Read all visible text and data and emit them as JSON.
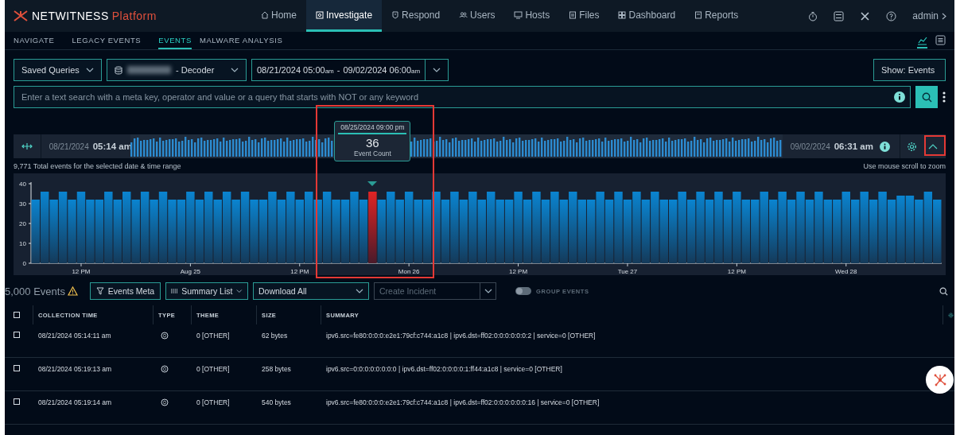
{
  "brand": {
    "name": "NETWITNESS",
    "product": "Platform"
  },
  "nav": [
    {
      "label": "Home",
      "selected": false
    },
    {
      "label": "Investigate",
      "selected": true
    },
    {
      "label": "Respond",
      "selected": false
    },
    {
      "label": "Users",
      "selected": false
    },
    {
      "label": "Hosts",
      "selected": false
    },
    {
      "label": "Files",
      "selected": false
    },
    {
      "label": "Dashboard",
      "selected": false
    },
    {
      "label": "Reports",
      "selected": false
    }
  ],
  "user": "admin",
  "subnav": [
    {
      "label": "NAVIGATE",
      "selected": false
    },
    {
      "label": "LEGACY EVENTS",
      "selected": false
    },
    {
      "label": "EVENTS",
      "selected": true
    },
    {
      "label": "MALWARE ANALYSIS",
      "selected": false
    }
  ],
  "view_toggles": [
    {
      "selected": true
    },
    {
      "selected": false
    }
  ],
  "query": {
    "saved_queries": "Saved Queries",
    "datasource": "- Decoder",
    "start_date": "08/21/2024 05:00",
    "start_ampm": "am",
    "separator": "-",
    "end_date": "09/02/2024 06:00",
    "end_ampm": "am",
    "show": "Show: Events"
  },
  "search": {
    "placeholder": "Enter a text search with a meta key, operator and value or a query that starts with NOT or any keyword"
  },
  "timeline": {
    "start_date": "08/21/2024",
    "start_time": "05:14 am",
    "end_date": "09/02/2024",
    "end_time": "06:31 am",
    "total": "9,771 Total events for the selected date & time range",
    "hint": "Use mouse scroll to zoom"
  },
  "tooltip": {
    "count": "36"
  },
  "chart_data": {
    "type": "bar",
    "categories": [
      null,
      null,
      null,
      null,
      null,
      "12 PM",
      null,
      null,
      null,
      null,
      null,
      null,
      null,
      null,
      null,
      null,
      null,
      "Aug 25",
      null,
      null,
      null,
      null,
      null,
      null,
      null,
      null,
      null,
      null,
      null,
      "12 PM",
      null,
      null,
      null,
      null,
      null,
      null,
      null,
      null,
      null,
      null,
      null,
      "Mon 26",
      null,
      null,
      null,
      null,
      null,
      null,
      null,
      null,
      null,
      null,
      null,
      "12 PM",
      null,
      null,
      null,
      null,
      null,
      null,
      null,
      null,
      null,
      null,
      null,
      "Tue 27",
      null,
      null,
      null,
      null,
      null,
      null,
      null,
      null,
      null,
      null,
      null,
      "12 PM",
      null,
      null,
      null,
      null,
      null,
      null,
      null,
      null,
      null,
      null,
      null,
      "Wed 28",
      null,
      null,
      null,
      null,
      null,
      null,
      null,
      null,
      null,
      null
    ],
    "series": [
      {
        "name": "Event Count",
        "color": "#0a84d0",
        "values": [
          32,
          36,
          32,
          36,
          32,
          36,
          32,
          32,
          36,
          32,
          36,
          32,
          36,
          32,
          36,
          32,
          32,
          36,
          32,
          36,
          32,
          36,
          32,
          36,
          32,
          32,
          36,
          32,
          36,
          32,
          36,
          32,
          36,
          32,
          32,
          36,
          32,
          null,
          32,
          36,
          32,
          36,
          32,
          32,
          36,
          32,
          36,
          32,
          36,
          32,
          36,
          32,
          32,
          36,
          32,
          36,
          32,
          36,
          32,
          36,
          32,
          32,
          36,
          32,
          36,
          32,
          36,
          32,
          36,
          32,
          32,
          36,
          32,
          36,
          32,
          36,
          32,
          36,
          32,
          32,
          36,
          32,
          36,
          32,
          36,
          32,
          36,
          32,
          32,
          36,
          32,
          36,
          32,
          36,
          32,
          34,
          34,
          32,
          36,
          32
        ]
      },
      {
        "name": "08/25/2024 09:00 pm",
        "color": "#e02424",
        "values": [
          null,
          null,
          null,
          null,
          null,
          null,
          null,
          null,
          null,
          null,
          null,
          null,
          null,
          null,
          null,
          null,
          null,
          null,
          null,
          null,
          null,
          null,
          null,
          null,
          null,
          null,
          null,
          null,
          null,
          null,
          null,
          null,
          null,
          null,
          null,
          null,
          null,
          36,
          null,
          null,
          null,
          null,
          null,
          null,
          null,
          null,
          null,
          null,
          null,
          null,
          null,
          null,
          null,
          null,
          null,
          null,
          null,
          null,
          null,
          null,
          null,
          null,
          null,
          null,
          null,
          null,
          null,
          null,
          null,
          null,
          null,
          null,
          null,
          null,
          null,
          null,
          null,
          null,
          null,
          null,
          null,
          null,
          null,
          null,
          null,
          null,
          null,
          null,
          null,
          null,
          null,
          null,
          null,
          null,
          null,
          null,
          null,
          null,
          null,
          null
        ]
      }
    ],
    "ylim": [
      0,
      40
    ],
    "yticks": [
      0,
      10,
      20,
      30,
      40
    ]
  },
  "events_toolbar": {
    "count": "5,000 Events",
    "warning": true,
    "meta_button": "Events Meta",
    "summary": "Summary List",
    "download": "Download All",
    "incident_placeholder": "Create Incident",
    "incident_disabled": true,
    "group_events": {
      "label": "GROUP EVENTS",
      "on": false
    }
  },
  "table": {
    "select_all": false,
    "columns": [
      "COLLECTION TIME",
      "TYPE",
      "THEME",
      "SIZE",
      "SUMMARY"
    ],
    "rows": [
      {
        "checked": false,
        "time": "08/21/2024 05:14:11 am",
        "theme": "0 [OTHER]",
        "size": "62 bytes",
        "summary": "ipv6.src=fe80:0:0:0:e2e1:79cf:c744:a1c8 |  ipv6.dst=ff02:0:0:0:0:0:0:2 |  service=0 [OTHER]"
      },
      {
        "checked": false,
        "time": "08/21/2024 05:19:13 am",
        "theme": "0 [OTHER]",
        "size": "258 bytes",
        "summary": "ipv6.src=0:0:0:0:0:0:0:0 |  ipv6.dst=ff02:0:0:0:0:1:ff44:a1c8 |  service=0 [OTHER]"
      },
      {
        "checked": false,
        "time": "08/21/2024 05:19:14 am",
        "theme": "0 [OTHER]",
        "size": "540 bytes",
        "summary": "ipv6.src=fe80:0:0:0:e2e1:79cf:c744:a1c8 |  ipv6.dst=ff02:0:0:0:0:0:0:16 |  service=0 [OTHER]"
      }
    ]
  },
  "highlights": {
    "tooltip_region": true,
    "collapse_button": true
  }
}
